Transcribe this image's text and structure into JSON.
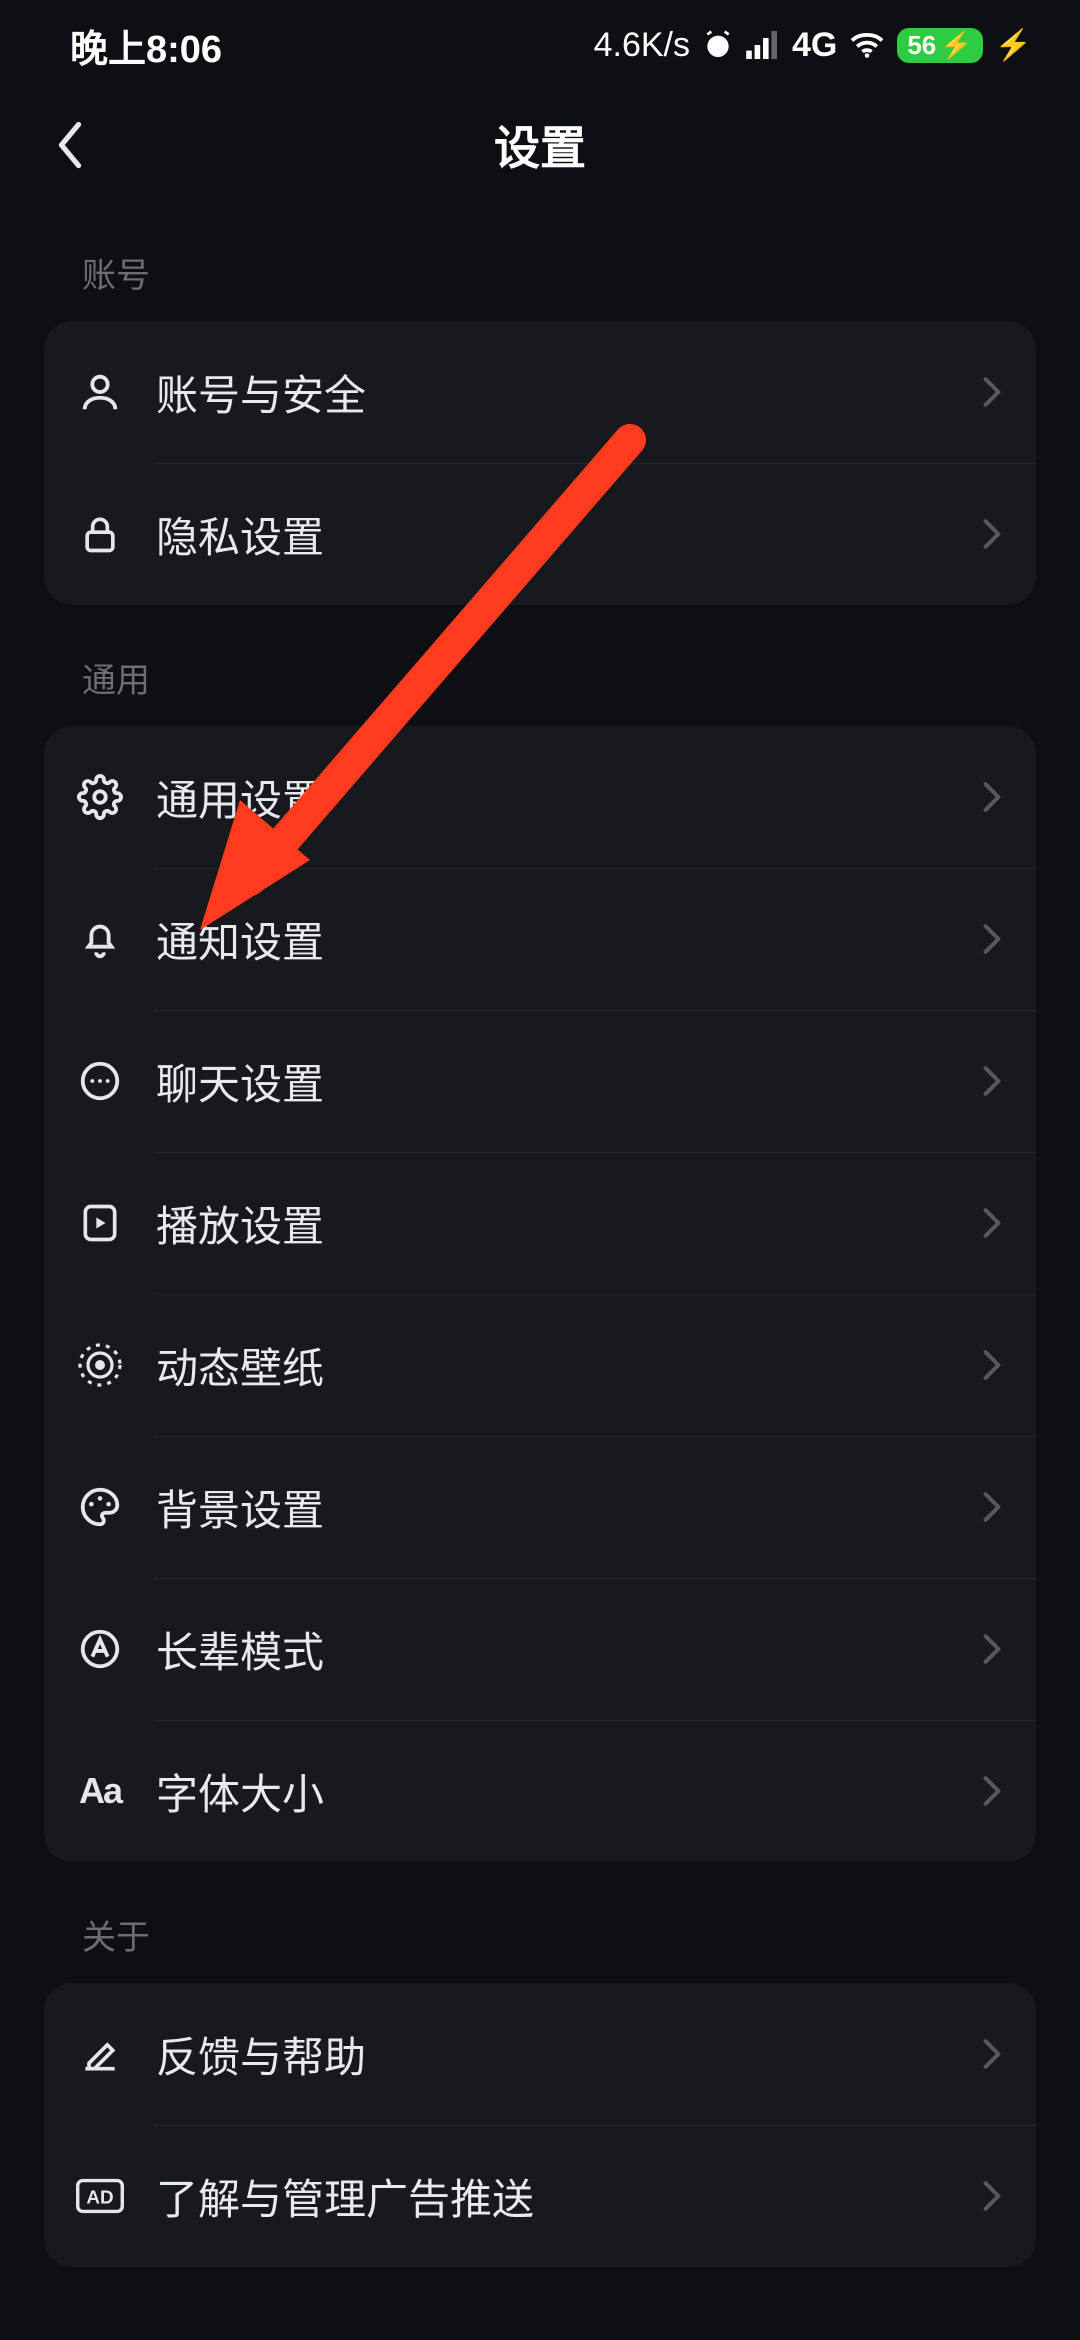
{
  "status": {
    "time": "晚上8:06",
    "speed": "4.6K/s",
    "network_label": "4G",
    "battery_text": "56"
  },
  "header": {
    "title": "设置"
  },
  "sections": [
    {
      "header": "账号",
      "items": [
        {
          "label": "账号与安全",
          "icon": "user-icon"
        },
        {
          "label": "隐私设置",
          "icon": "lock-icon"
        }
      ]
    },
    {
      "header": "通用",
      "items": [
        {
          "label": "通用设置",
          "icon": "gear-icon"
        },
        {
          "label": "通知设置",
          "icon": "bell-icon"
        },
        {
          "label": "聊天设置",
          "icon": "chat-icon"
        },
        {
          "label": "播放设置",
          "icon": "play-icon"
        },
        {
          "label": "动态壁纸",
          "icon": "target-icon"
        },
        {
          "label": "背景设置",
          "icon": "palette-icon"
        },
        {
          "label": "长辈模式",
          "icon": "accessibility-icon"
        },
        {
          "label": "字体大小",
          "icon": "font-size-icon"
        }
      ]
    },
    {
      "header": "关于",
      "items": [
        {
          "label": "反馈与帮助",
          "icon": "pencil-icon"
        },
        {
          "label": "了解与管理广告推送",
          "icon": "ad-icon"
        }
      ]
    }
  ],
  "annotation": {
    "color": "#ff3b1f"
  }
}
